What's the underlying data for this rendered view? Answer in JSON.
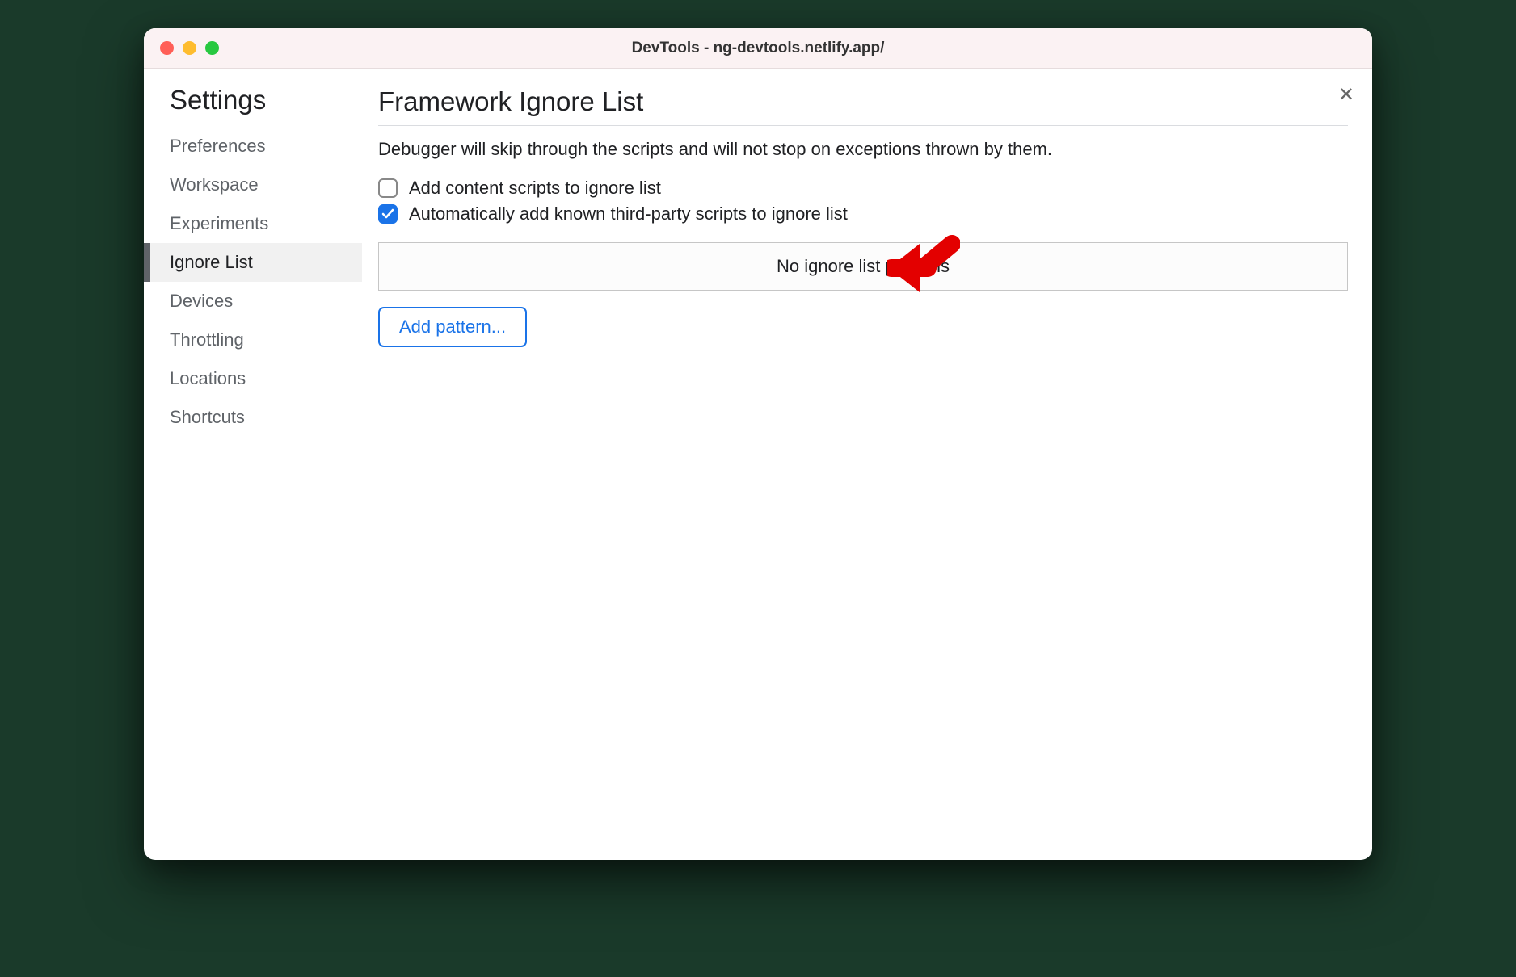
{
  "window": {
    "title": "DevTools - ng-devtools.netlify.app/"
  },
  "sidebar": {
    "title": "Settings",
    "items": [
      {
        "label": "Preferences"
      },
      {
        "label": "Workspace"
      },
      {
        "label": "Experiments"
      },
      {
        "label": "Ignore List"
      },
      {
        "label": "Devices"
      },
      {
        "label": "Throttling"
      },
      {
        "label": "Locations"
      },
      {
        "label": "Shortcuts"
      }
    ],
    "activeIndex": 3
  },
  "main": {
    "title": "Framework Ignore List",
    "description": "Debugger will skip through the scripts and will not stop on exceptions thrown by them.",
    "checkboxes": [
      {
        "label": "Add content scripts to ignore list",
        "checked": false
      },
      {
        "label": "Automatically add known third-party scripts to ignore list",
        "checked": true
      }
    ],
    "patterns_empty": "No ignore list patterns",
    "add_pattern_label": "Add pattern..."
  }
}
